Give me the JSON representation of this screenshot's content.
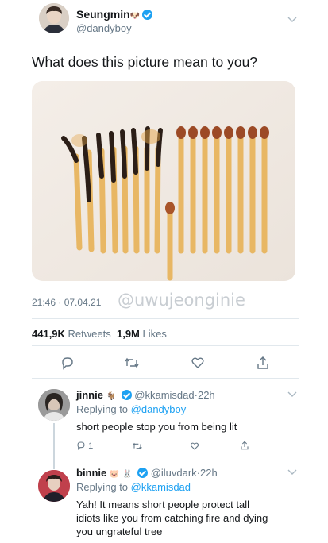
{
  "main_tweet": {
    "display_name": "Seungmin",
    "handle": "@dandyboy",
    "text": "What does this picture mean to you?",
    "time": "21:46 · 07.04.21",
    "watermark": "@uwujeonginie",
    "retweets_count": "441,9K",
    "retweets_label": "Retweets",
    "likes_count": "1,9M",
    "likes_label": "Likes"
  },
  "replies": [
    {
      "display_name": "jinnie",
      "handle": "@kkamisdad",
      "age": "22h",
      "replying_to_label": "Replying to",
      "replying_to": "@dandyboy",
      "text": "short people stop you from being lit",
      "reply_count": "1"
    },
    {
      "display_name": "binnie",
      "handle": "@iluvdark",
      "age": "22h",
      "replying_to_label": "Replying to",
      "replying_to": "@kkamisdad",
      "text_lines": [
        "Yah! It means short people protect tall",
        "idiots like you from catching fire and dying",
        "you ungrateful tree"
      ]
    }
  ],
  "colors": {
    "accent": "#1da1f2",
    "text": "#14171a",
    "secondary": "#657786"
  },
  "icons": [
    "reply-icon",
    "retweet-icon",
    "like-icon",
    "share-icon",
    "verified-icon",
    "chevron-down-icon"
  ]
}
